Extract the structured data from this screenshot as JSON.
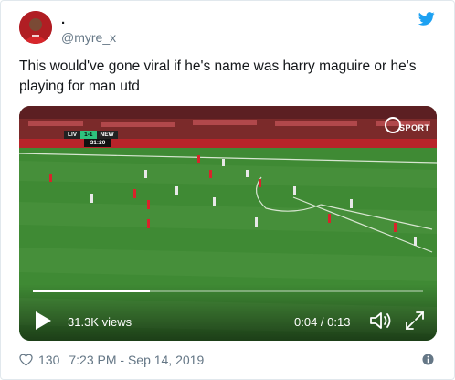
{
  "tweet": {
    "display_name": ".",
    "handle": "@myre_x",
    "text": "This would've gone viral if he's name was harry maguire or he's playing for man utd",
    "likes": "130",
    "timestamp": "7:23 PM - Sep 14, 2019"
  },
  "video": {
    "views": "31.3K views",
    "time": "0:04 / 0:13",
    "progress": 0.3,
    "scoreboard": {
      "home": "LIV",
      "score": "1-1",
      "away": "NEW",
      "clock": "31:20"
    },
    "channel_logo": "SPORT"
  },
  "icons": {
    "twitter": "twitter-bird-icon",
    "play": "play-icon",
    "volume": "volume-icon",
    "fullscreen": "fullscreen-icon",
    "like": "heart-icon",
    "info": "info-icon"
  },
  "colors": {
    "twitter_blue": "#1da1f2",
    "secondary_text": "#657786",
    "pitch_green": "#3f8a34"
  }
}
